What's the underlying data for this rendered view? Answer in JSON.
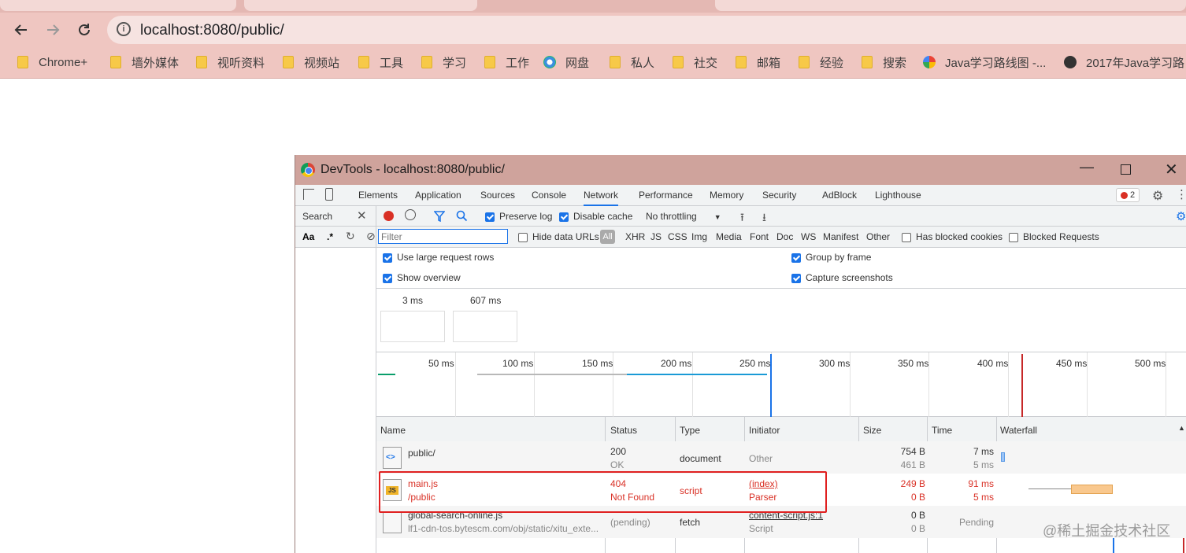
{
  "browser": {
    "url": "localhost:8080/public/",
    "bookmarks": [
      "Chrome+",
      "墙外媒体",
      "视听资料",
      "视频站",
      "工具",
      "学习",
      "工作",
      "网盘",
      "私人",
      "社交",
      "邮箱",
      "经验",
      "搜索",
      "Java学习路线图 -...",
      "2017年Java学习路"
    ]
  },
  "devtools": {
    "title": "DevTools - localhost:8080/public/",
    "tabs": [
      "Elements",
      "Application",
      "Sources",
      "Console",
      "Network",
      "Performance",
      "Memory",
      "Security",
      "AdBlock",
      "Lighthouse"
    ],
    "active_tab": "Network",
    "error_count": "2",
    "search_label": "Search",
    "search_options": [
      "Aa",
      ".*"
    ],
    "toolbar": {
      "preserve_log": "Preserve log",
      "disable_cache": "Disable cache",
      "throttling": "No throttling"
    },
    "filter": {
      "placeholder": "Filter",
      "hide_data_urls": "Hide data URLs",
      "all": "All",
      "types": [
        "XHR",
        "JS",
        "CSS",
        "Img",
        "Media",
        "Font",
        "Doc",
        "WS",
        "Manifest",
        "Other"
      ],
      "has_blocked_cookies": "Has blocked cookies",
      "blocked_requests": "Blocked Requests"
    },
    "settings": {
      "large_rows": "Use large request rows",
      "show_overview": "Show overview",
      "group_by_frame": "Group by frame",
      "capture_screenshots": "Capture screenshots"
    },
    "screenshots": [
      "3 ms",
      "607 ms"
    ],
    "timeline_ticks": [
      "50 ms",
      "100 ms",
      "150 ms",
      "200 ms",
      "250 ms",
      "300 ms",
      "350 ms",
      "400 ms",
      "450 ms",
      "500 ms"
    ],
    "columns": [
      "Name",
      "Status",
      "Type",
      "Initiator",
      "Size",
      "Time",
      "Waterfall"
    ],
    "rows": [
      {
        "name": "public/",
        "path": "",
        "status": "200",
        "status_text": "OK",
        "type": "document",
        "initiator": "Other",
        "initiator_sub": "",
        "size": "754 B",
        "size_sub": "461 B",
        "time": "7 ms",
        "time_sub": "5 ms"
      },
      {
        "name": "main.js",
        "path": "/public",
        "status": "404",
        "status_text": "Not Found",
        "type": "script",
        "initiator": "(index)",
        "initiator_sub": "Parser",
        "size": "249 B",
        "size_sub": "0 B",
        "time": "91 ms",
        "time_sub": "5 ms"
      },
      {
        "name": "global-search-online.js",
        "path": "lf1-cdn-tos.bytescm.com/obj/static/xitu_exte...",
        "status": "(pending)",
        "status_text": "",
        "type": "fetch",
        "initiator": "content-script.js:1",
        "initiator_sub": "Script",
        "size": "0 B",
        "size_sub": "0 B",
        "time": "Pending",
        "time_sub": ""
      }
    ]
  },
  "watermark": "@稀土掘金技术社区"
}
